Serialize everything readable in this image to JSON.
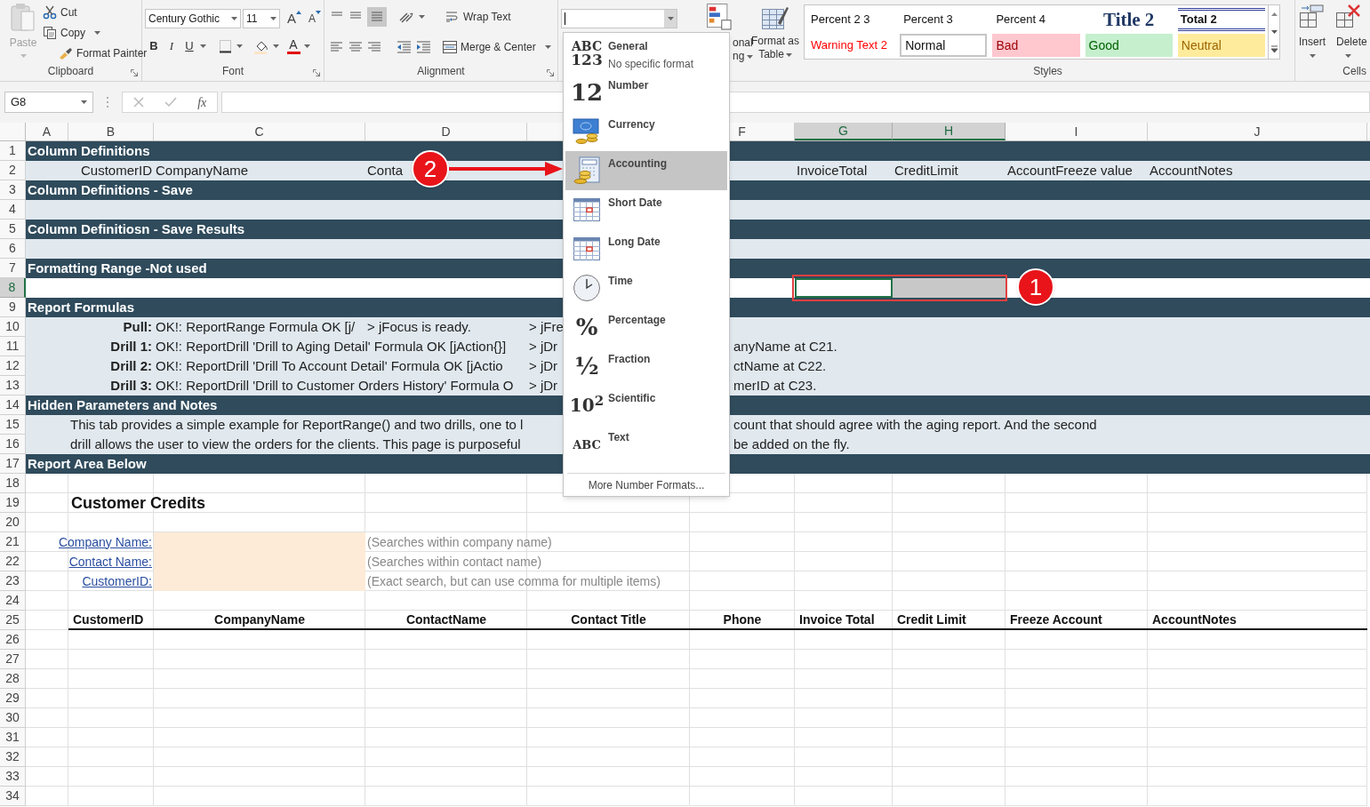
{
  "ribbon": {
    "clipboard": {
      "paste": "Paste",
      "cut": "Cut",
      "copy": "Copy",
      "format_painter": "Format Painter",
      "label": "Clipboard"
    },
    "font": {
      "name": "Century Gothic",
      "size": "11",
      "grow": "A",
      "shrink": "A",
      "bold": "B",
      "italic": "I",
      "underline": "U",
      "fore_label": "A",
      "label": "Font"
    },
    "alignment": {
      "wrap": "Wrap Text",
      "merge": "Merge & Center",
      "label": "Alignment"
    },
    "conditional": {
      "line1": "onal",
      "line2": "ng"
    },
    "format_as_table": {
      "line1": "Format as",
      "line2": "Table"
    },
    "styles": {
      "label": "Styles",
      "cells": [
        {
          "text": "Percent 2 3",
          "kind": "plain"
        },
        {
          "text": "Percent 3",
          "kind": "plain"
        },
        {
          "text": "Percent 4",
          "kind": "plain"
        },
        {
          "text": "Title 2",
          "kind": "title"
        },
        {
          "text": "Total 2",
          "kind": "total"
        },
        {
          "text": "Warning Text 2",
          "kind": "warning"
        },
        {
          "text": "Normal",
          "kind": "normal"
        },
        {
          "text": "Bad",
          "kind": "bad"
        },
        {
          "text": "Good",
          "kind": "good"
        },
        {
          "text": "Neutral",
          "kind": "neutral"
        }
      ]
    },
    "cells": {
      "insert": "Insert",
      "delete": "Delete",
      "label": "Cells"
    }
  },
  "formula_bar": {
    "name_box": "G8",
    "fx": "fx"
  },
  "columns": [
    {
      "label": "A",
      "selected": false
    },
    {
      "label": "B",
      "selected": false
    },
    {
      "label": "C",
      "selected": false
    },
    {
      "label": "D",
      "selected": false
    },
    {
      "label": "F",
      "selected": false
    },
    {
      "label": "G",
      "selected": true
    },
    {
      "label": "H",
      "selected": true
    },
    {
      "label": "I",
      "selected": false
    },
    {
      "label": "J",
      "selected": false
    }
  ],
  "rows": [
    {
      "number": "1",
      "kind": "band",
      "selected": false,
      "cells": [
        "Column Definitions"
      ]
    },
    {
      "number": "2",
      "kind": "definitions",
      "selected": false,
      "cells": [
        "CustomerID",
        "CompanyName",
        "Conta",
        "InvoiceTotal",
        "CreditLimit",
        "AccountFreeze value",
        "AccountNotes"
      ]
    },
    {
      "number": "3",
      "kind": "band",
      "selected": false,
      "cells": [
        "Column Definitions - Save"
      ]
    },
    {
      "number": "4",
      "kind": "light",
      "selected": false
    },
    {
      "number": "5",
      "kind": "band",
      "selected": false,
      "cells": [
        "Column Definitiosn - Save Results"
      ]
    },
    {
      "number": "6",
      "kind": "light",
      "selected": false
    },
    {
      "number": "7",
      "kind": "band",
      "selected": false,
      "cells": [
        "Formatting Range -Not used"
      ]
    },
    {
      "number": "8",
      "kind": "selection",
      "selected": true,
      "picks": [
        {
          "selected": true
        },
        {
          "selected": true
        }
      ]
    },
    {
      "number": "9",
      "kind": "band",
      "selected": false,
      "cells": [
        "Report Formulas"
      ]
    },
    {
      "number": "10",
      "kind": "formula_first",
      "selected": false,
      "cells": [
        "Pull:",
        "OK!: ReportRange Formula OK [j/",
        "> jFocus is ready.",
        "> jFre"
      ]
    },
    {
      "number": "11",
      "kind": "formula",
      "selected": false,
      "cells": [
        "Drill 1:",
        "OK!: ReportDrill 'Drill to Aging Detail' Formula OK [jAction{}]",
        "> jDr",
        "anyName at C21."
      ]
    },
    {
      "number": "12",
      "kind": "formula",
      "selected": false,
      "cells": [
        "Drill 2:",
        "OK!: ReportDrill 'Drill To Account Detail' Formula OK [jActio",
        "> jDr",
        "ctName at C22."
      ]
    },
    {
      "number": "13",
      "kind": "formula",
      "selected": false,
      "cells": [
        "Drill 3:",
        "OK!: ReportDrill 'Drill to Customer Orders History' Formula O",
        "> jDr",
        "merID at C23."
      ]
    },
    {
      "number": "14",
      "kind": "band",
      "selected": false,
      "cells": [
        "Hidden Parameters and Notes"
      ]
    },
    {
      "number": "15",
      "kind": "note",
      "selected": false,
      "cells": [
        "This tab provides a simple example for ReportRange() and two drills, one to l",
        "count that should agree with the aging report. And the second"
      ]
    },
    {
      "number": "16",
      "kind": "note",
      "selected": false,
      "cells": [
        "drill allows the user to view the orders for the clients.   This page is purposeful",
        "be added on the fly."
      ]
    },
    {
      "number": "17",
      "kind": "band",
      "selected": false,
      "cells": [
        "Report Area Below"
      ]
    },
    {
      "number": "18",
      "kind": "plain",
      "selected": false
    },
    {
      "number": "19",
      "kind": "title",
      "selected": false,
      "cells": [
        "Customer Credits"
      ]
    },
    {
      "number": "20",
      "kind": "plain",
      "selected": false
    },
    {
      "number": "21",
      "kind": "search",
      "selected": false,
      "label": "Company Name:",
      "note": "(Searches within company name)"
    },
    {
      "number": "22",
      "kind": "search",
      "selected": false,
      "label": "Contact Name:",
      "note": "(Searches within contact name)"
    },
    {
      "number": "23",
      "kind": "search",
      "selected": false,
      "label": "CustomerID:",
      "note": "(Exact search, but can use comma for multiple items)"
    },
    {
      "number": "24",
      "kind": "plain",
      "selected": false
    },
    {
      "number": "25",
      "kind": "header",
      "selected": false,
      "cells": [
        "CustomerID",
        "CompanyName",
        "ContactName",
        "Contact Title",
        "Phone",
        "Invoice Total",
        "Credit Limit",
        "Freeze Account",
        "AccountNotes"
      ]
    },
    {
      "number": "26",
      "kind": "plain",
      "selected": false
    },
    {
      "number": "27",
      "kind": "plain",
      "selected": false
    },
    {
      "number": "28",
      "kind": "plain",
      "selected": false
    },
    {
      "number": "29",
      "kind": "plain",
      "selected": false
    },
    {
      "number": "30",
      "kind": "plain",
      "selected": false
    },
    {
      "number": "31",
      "kind": "plain",
      "selected": false
    },
    {
      "number": "32",
      "kind": "plain",
      "selected": false
    },
    {
      "number": "33",
      "kind": "plain",
      "selected": false
    },
    {
      "number": "34",
      "kind": "plain",
      "selected": false
    }
  ],
  "number_menu": {
    "items": [
      {
        "kind": "general",
        "glyph": "ABC",
        "glyph2": "123",
        "label": "General",
        "sublabel": "No specific format",
        "selected": false
      },
      {
        "kind": "number",
        "glyph": "12",
        "label": "Number",
        "selected": false
      },
      {
        "kind": "currency",
        "label": "Currency",
        "selected": false
      },
      {
        "kind": "accounting",
        "label": "Accounting",
        "selected": true
      },
      {
        "kind": "short_date",
        "label": "Short Date",
        "selected": false
      },
      {
        "kind": "long_date",
        "label": "Long Date",
        "selected": false
      },
      {
        "kind": "time",
        "label": "Time",
        "selected": false
      },
      {
        "kind": "percentage",
        "glyph": "%",
        "label": "Percentage",
        "selected": false
      },
      {
        "kind": "fraction",
        "glyph": "½",
        "label": "Fraction",
        "selected": false
      },
      {
        "kind": "scientific",
        "glyph": "10$^{2}$",
        "label": "Scientific",
        "selected": false
      },
      {
        "kind": "text",
        "glyph": "ABC",
        "label": "Text",
        "selected": false
      }
    ],
    "more": "More Number Formats..."
  },
  "annotations": [
    {
      "kind": "arrow",
      "label": "2"
    },
    {
      "kind": "box",
      "label": "1"
    }
  ]
}
